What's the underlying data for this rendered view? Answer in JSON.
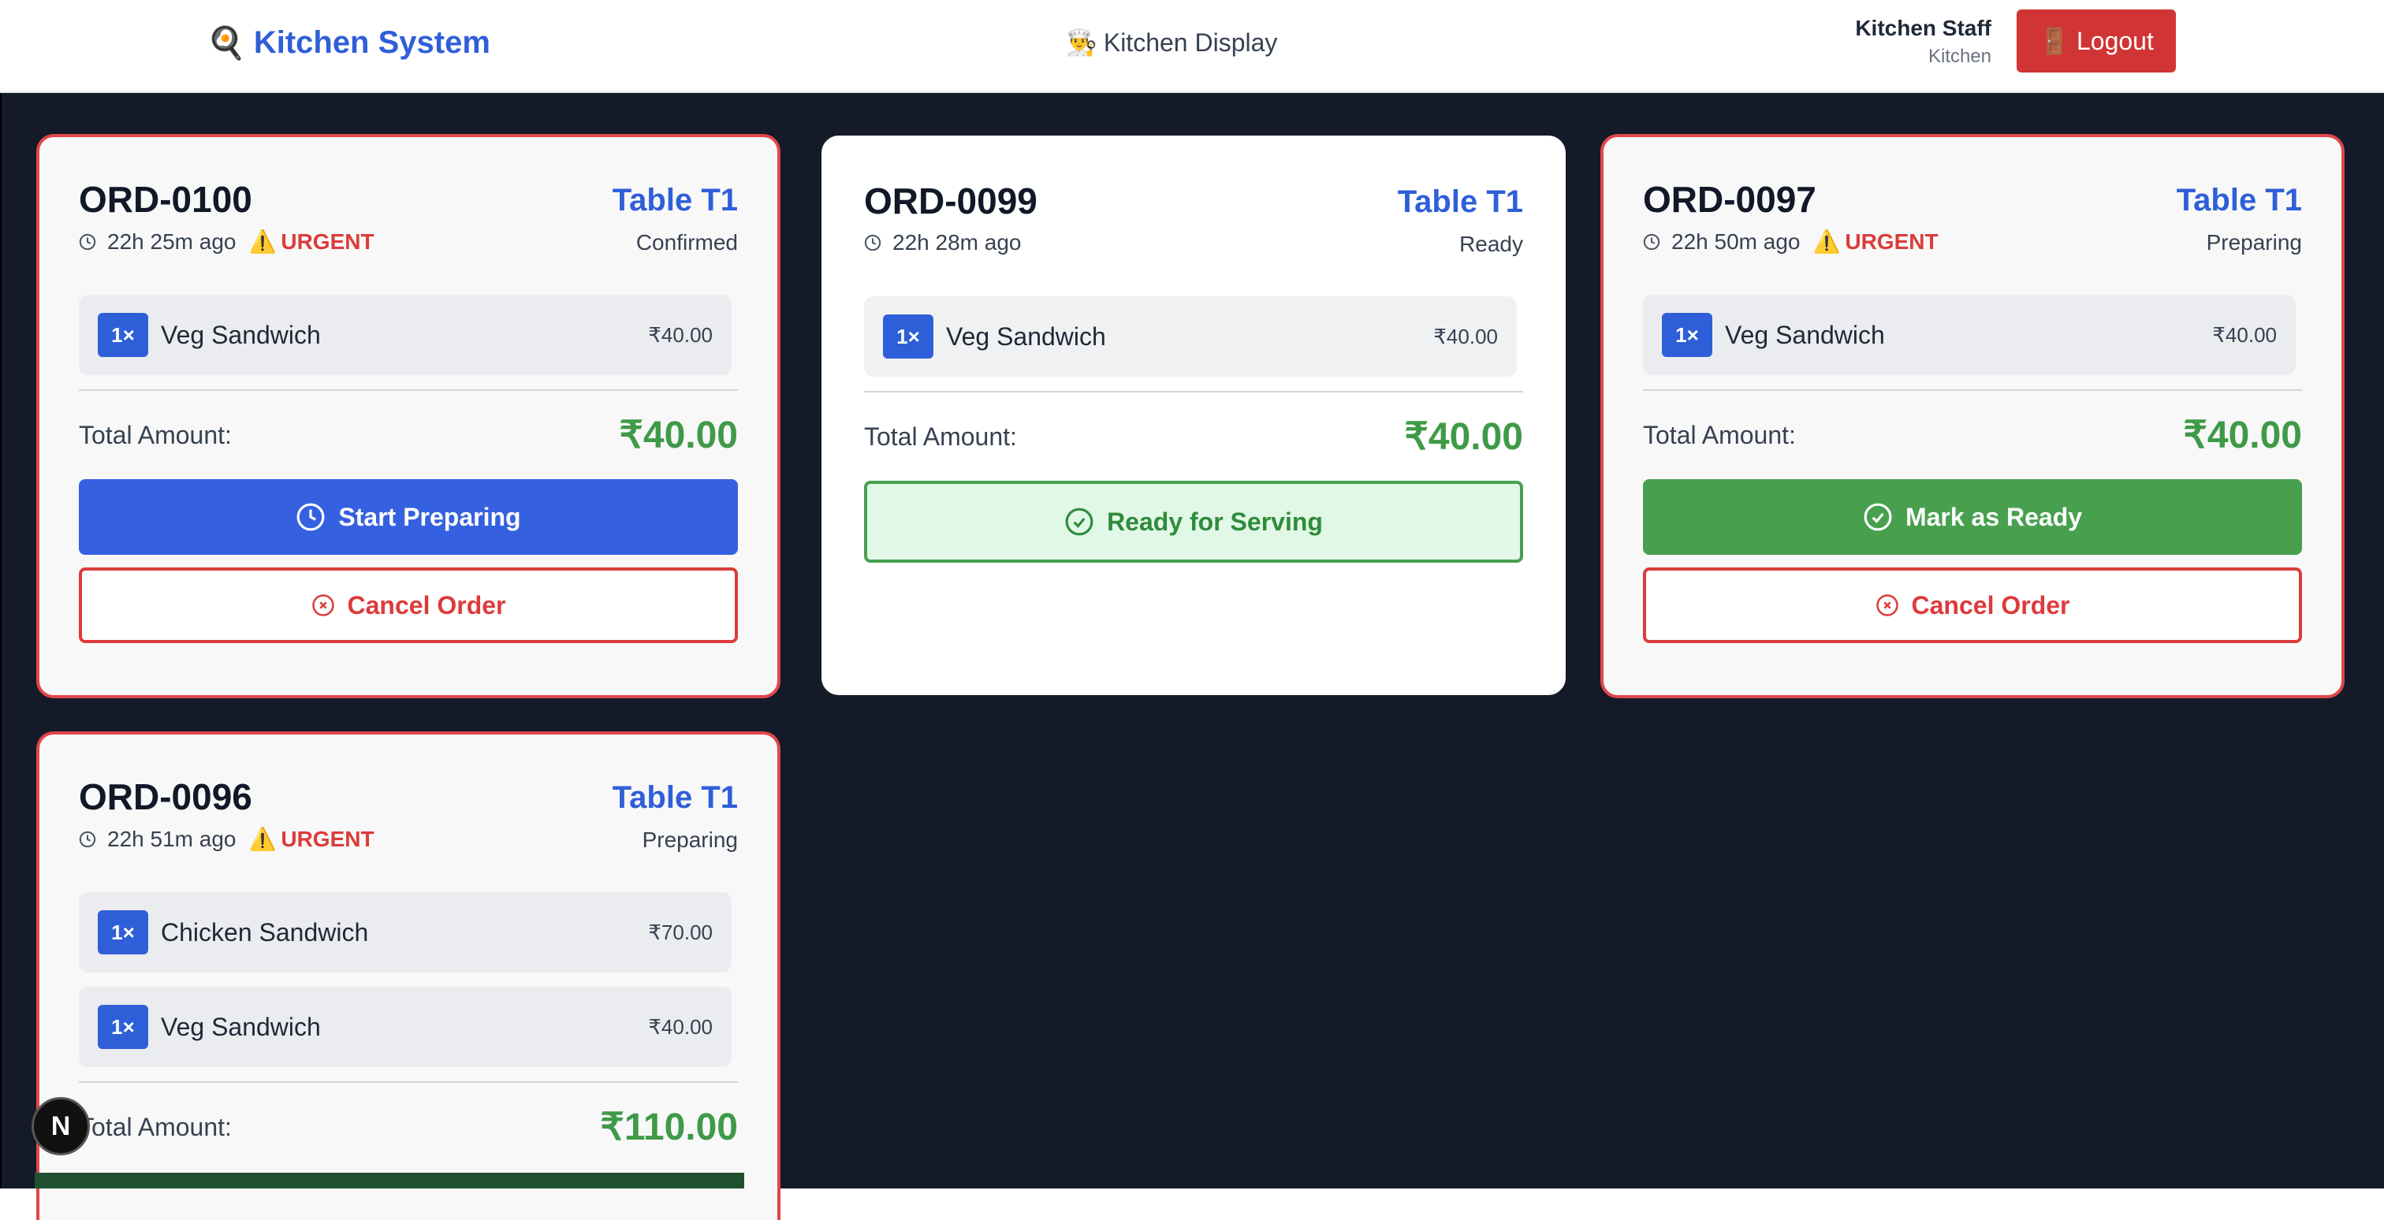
{
  "header": {
    "brand_icon": "🍳",
    "brand_title": "Kitchen System",
    "page_icon": "👨‍🍳",
    "page_title": "Kitchen Display",
    "user_name": "Kitchen Staff",
    "user_role": "Kitchen",
    "logout_icon": "🚪",
    "logout_label": "Logout"
  },
  "colors": {
    "brand_blue": "#2f5fd8",
    "urgent_red": "#dc3b3b",
    "total_green": "#3f9a48",
    "background": "#141a27"
  },
  "orders": [
    {
      "id": "ORD-0100",
      "elapsed": "22h 25m ago",
      "urgent": "URGENT",
      "table": "Table T1",
      "status": "Confirmed",
      "items": [
        {
          "qty": "1×",
          "name": "Veg Sandwich",
          "price": "₹40.00"
        }
      ],
      "total_label": "Total Amount:",
      "total": "₹40.00",
      "primary_action": "Start Preparing",
      "cancel_action": "Cancel Order"
    },
    {
      "id": "ORD-0099",
      "elapsed": "22h 28m ago",
      "table": "Table T1",
      "status": "Ready",
      "items": [
        {
          "qty": "1×",
          "name": "Veg Sandwich",
          "price": "₹40.00"
        }
      ],
      "total_label": "Total Amount:",
      "total": "₹40.00",
      "primary_action": "Ready for Serving"
    },
    {
      "id": "ORD-0097",
      "elapsed": "22h 50m ago",
      "urgent": "URGENT",
      "table": "Table T1",
      "status": "Preparing",
      "items": [
        {
          "qty": "1×",
          "name": "Veg Sandwich",
          "price": "₹40.00"
        }
      ],
      "total_label": "Total Amount:",
      "total": "₹40.00",
      "primary_action": "Mark as Ready",
      "cancel_action": "Cancel Order"
    },
    {
      "id": "ORD-0096",
      "elapsed": "22h 51m ago",
      "urgent": "URGENT",
      "table": "Table T1",
      "status": "Preparing",
      "items": [
        {
          "qty": "1×",
          "name": "Chicken Sandwich",
          "price": "₹70.00"
        },
        {
          "qty": "1×",
          "name": "Veg Sandwich",
          "price": "₹40.00"
        }
      ],
      "total_label": "Total Amount:",
      "total": "₹110.00"
    }
  ],
  "dev_badge": "N"
}
